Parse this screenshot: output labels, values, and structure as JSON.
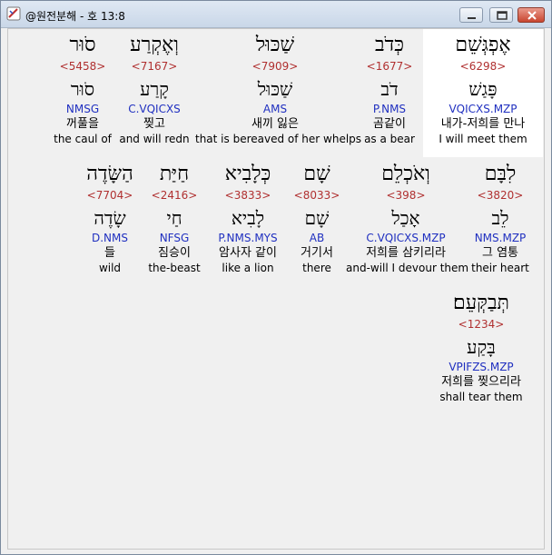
{
  "window": {
    "title": "@원전분해 - 호 13:8",
    "minimize_icon": "minimize-icon",
    "maximize_icon": "maximize-icon",
    "close_icon": "close-icon"
  },
  "rows": [
    {
      "words": [
        {
          "hebrew": "סֹוּר",
          "strong": "<5458>",
          "lemma": "סֹוּר",
          "morph": "NMSG",
          "korean": "꺼풀을",
          "english": "the caul of"
        },
        {
          "hebrew": "וְאֶקְרַע",
          "strong": "<7167>",
          "lemma": "קָרַע",
          "morph": "C.VQICXS",
          "korean": "찢고",
          "english": "and will redn"
        },
        {
          "hebrew": "שַׁכּוּל",
          "strong": "<7909>",
          "lemma": "שַׁכּוּל",
          "morph": "AMS",
          "korean": "새끼 잃은",
          "english": "that is bereaved of her whelps"
        },
        {
          "hebrew": "כְּדֹב",
          "strong": "<1677>",
          "lemma": "דֹב",
          "morph": "P.NMS",
          "korean": "곰같이",
          "english": "as a bear"
        },
        {
          "hebrew": "אֶפְגְּשֵׁם",
          "strong": "<6298>",
          "lemma": "פָּגַשׁ",
          "morph": "VQICXS.MZP",
          "korean": "내가-저희를 만나",
          "english": "I will meet them"
        }
      ]
    },
    {
      "words": [
        {
          "hebrew": "הַשָּׂדֶה",
          "strong": "<7704>",
          "lemma": "שָׂדֶה",
          "morph": "D.NMS",
          "korean": "들",
          "english": "wild"
        },
        {
          "hebrew": "חַיַּת",
          "strong": "<2416>",
          "lemma": "חַי",
          "morph": "NFSG",
          "korean": "짐승이",
          "english": "the-beast"
        },
        {
          "hebrew": "כְּלָבִיא",
          "strong": "<3833>",
          "lemma": "לָבִיא",
          "morph": "P.NMS.MYS",
          "korean": "암사자 같이",
          "english": "like a lion"
        },
        {
          "hebrew": "שָׁם",
          "strong": "<8033>",
          "lemma": "שָׁם",
          "morph": "AB",
          "korean": "거기서",
          "english": "there"
        },
        {
          "hebrew": "וְאֹכְלֵם",
          "strong": "<398>",
          "lemma": "אָכַל",
          "morph": "C.VQICXS.MZP",
          "korean": "저희를 삼키리라",
          "english": "and-will I devour them"
        },
        {
          "hebrew": "לִבָּם",
          "strong": "<3820>",
          "lemma": "לֵב",
          "morph": "NMS.MZP",
          "korean": "그 염통",
          "english": "their heart"
        }
      ]
    },
    {
      "words": [
        {
          "hebrew": "תְּבַקְּעֵם׃",
          "strong": "<1234>",
          "lemma": "בָּקַע",
          "morph": "VPIFZS.MZP",
          "korean": "저희를 찢으리라",
          "english": "shall tear them"
        }
      ]
    }
  ]
}
